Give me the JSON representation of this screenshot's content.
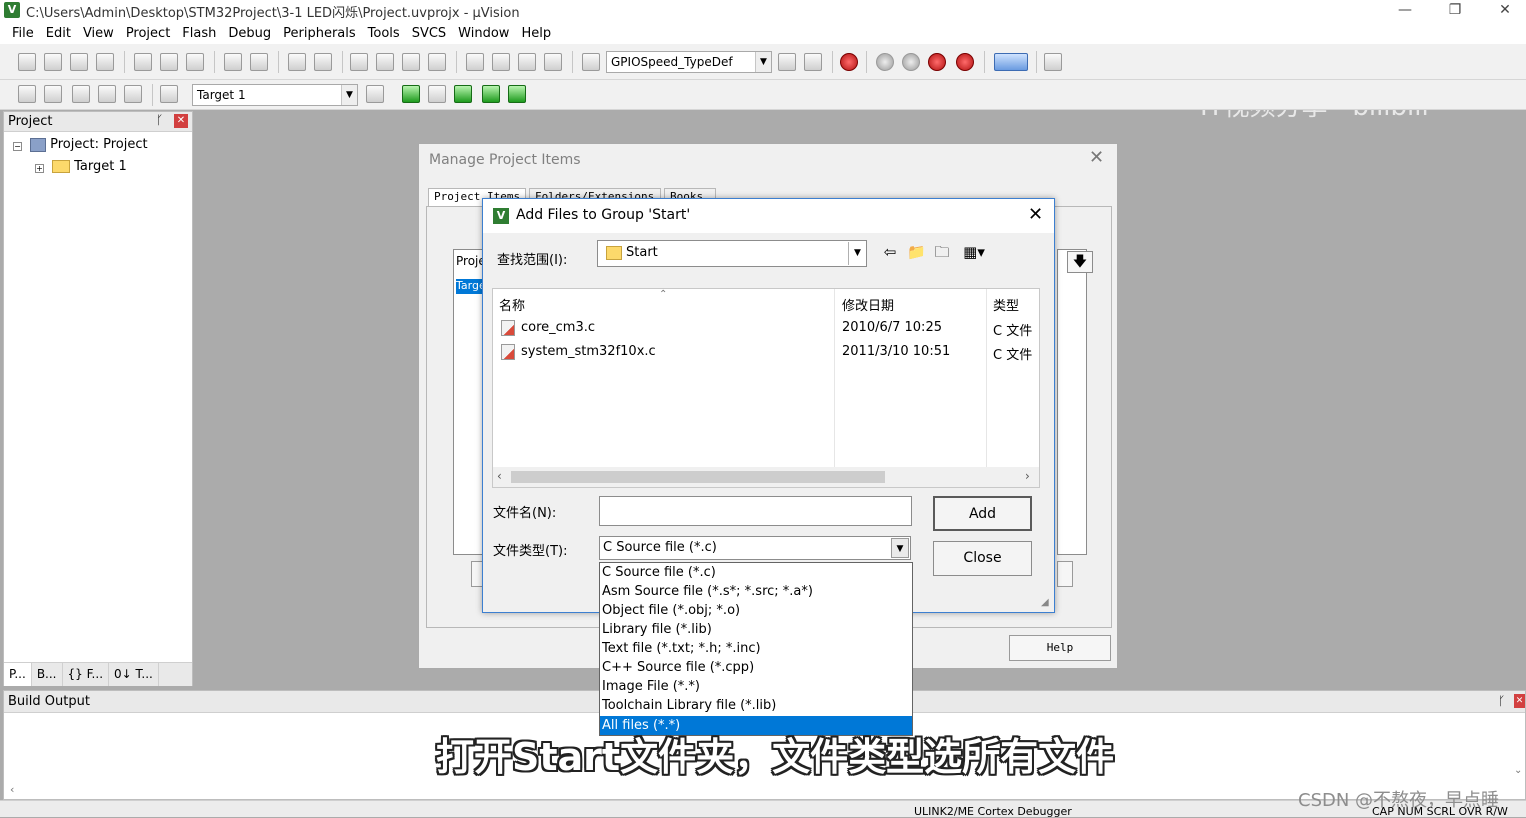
{
  "window": {
    "title": "C:\\Users\\Admin\\Desktop\\STM32Project\\3-1 LED闪烁\\Project.uvprojx - µVision",
    "minimize": "—",
    "restore": "❐",
    "close": "✕"
  },
  "menu": [
    "File",
    "Edit",
    "View",
    "Project",
    "Flash",
    "Debug",
    "Peripherals",
    "Tools",
    "SVCS",
    "Window",
    "Help"
  ],
  "toolbar": {
    "find_combo": "GPIOSpeed_TypeDef",
    "target_combo": "Target 1",
    "watermark": "IT视频分享 · bilibili"
  },
  "project_panel": {
    "title": "Project",
    "pin": "ᚴ",
    "close": "✕",
    "tree": {
      "root": "Project: Project",
      "child": "Target 1"
    },
    "tabs": [
      "P...",
      "B...",
      "{} F...",
      "0↓ T..."
    ]
  },
  "build_output": {
    "title": "Build Output"
  },
  "status": {
    "debugger": "ULINK2/ME Cortex Debugger",
    "indicators": "CAP  NUM  SCRL  OVR  R/W"
  },
  "manage_dialog": {
    "title": "Manage Project Items",
    "tabs": [
      "Project Items",
      "Folders/Extensions",
      "Books"
    ],
    "inner_label": "Proje",
    "inner_item": "Targe",
    "help": "Help"
  },
  "add_dialog": {
    "title": "Add Files to Group 'Start'",
    "look_in_label": "查找范围(I):",
    "look_in_value": "Start",
    "columns": {
      "name": "名称",
      "modified": "修改日期",
      "type": "类型"
    },
    "files": [
      {
        "name": "core_cm3.c",
        "modified": "2010/6/7 10:25",
        "type": "C 文件"
      },
      {
        "name": "system_stm32f10x.c",
        "modified": "2011/3/10 10:51",
        "type": "C 文件"
      }
    ],
    "filename_label": "文件名(N):",
    "filename_value": "",
    "filetype_label": "文件类型(T):",
    "filetype_value": "C Source file (*.c)",
    "add_button": "Add",
    "close_button": "Close",
    "filetype_options": [
      "C Source file (*.c)",
      "Asm Source file (*.s*; *.src; *.a*)",
      "Object file (*.obj; *.o)",
      "Library file (*.lib)",
      "Text file (*.txt; *.h; *.inc)",
      "C++ Source file (*.cpp)",
      "Image File (*.*)",
      "Toolchain Library file (*.lib)",
      "All files (*.*)"
    ]
  },
  "subtitle": "打开Start文件夹，文件类型选所有文件",
  "csdn_watermark": "CSDN @不熬夜，早点睡",
  "colors": {
    "selection": "#0078d7",
    "dialog_border": "#3c7fd0"
  }
}
